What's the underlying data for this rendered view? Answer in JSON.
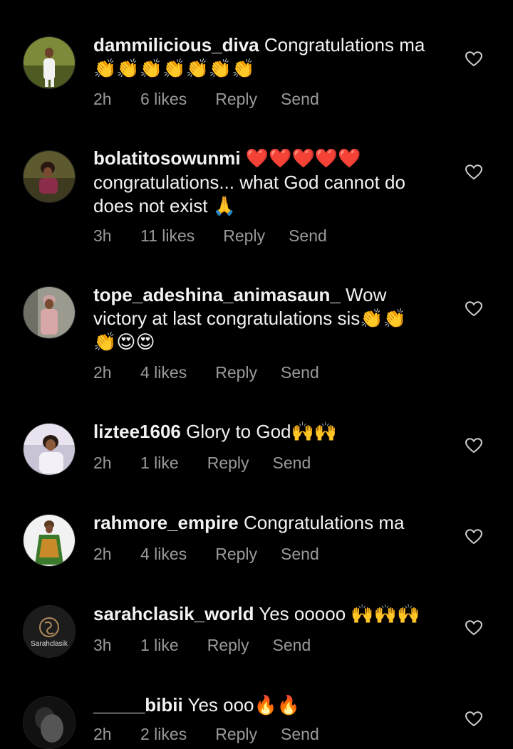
{
  "comments": [
    {
      "username": "dammilicious_diva",
      "text": "Congratulations ma",
      "emoji_line": "👏👏👏👏👏👏👏",
      "time": "2h",
      "likes": "6 likes",
      "reply": "Reply",
      "send": "Send"
    },
    {
      "username": "bolatitosowunmi",
      "emoji_after_name": "❤️❤️❤️❤️❤️",
      "text_line1": "congratulations... what God cannot do",
      "text_line2": "does not exist 🙏",
      "time": "3h",
      "likes": "11 likes",
      "reply": "Reply",
      "send": "Send"
    },
    {
      "username": "tope_adeshina_animasaun_",
      "text": "Wow",
      "text_line2": "victory at last congratulations sis👏👏",
      "emoji_line": "👏😍😍",
      "time": "2h",
      "likes": "4 likes",
      "reply": "Reply",
      "send": "Send"
    },
    {
      "username": "liztee1606",
      "text": "Glory to God🙌🙌",
      "time": "2h",
      "likes": "1 like",
      "reply": "Reply",
      "send": "Send"
    },
    {
      "username": "rahmore_empire",
      "text": "Congratulations ma",
      "time": "2h",
      "likes": "4 likes",
      "reply": "Reply",
      "send": "Send"
    },
    {
      "username": "sarahclasik_world",
      "text": "Yes ooooo 🙌🙌🙌",
      "time": "3h",
      "likes": "1 like",
      "reply": "Reply",
      "send": "Send"
    },
    {
      "username": "_____bibii",
      "text": "Yes ooo🔥🔥",
      "time": "2h",
      "likes": "2 likes",
      "reply": "Reply",
      "send": "Send"
    }
  ],
  "avatar_logo_text": "Sarahclasik"
}
